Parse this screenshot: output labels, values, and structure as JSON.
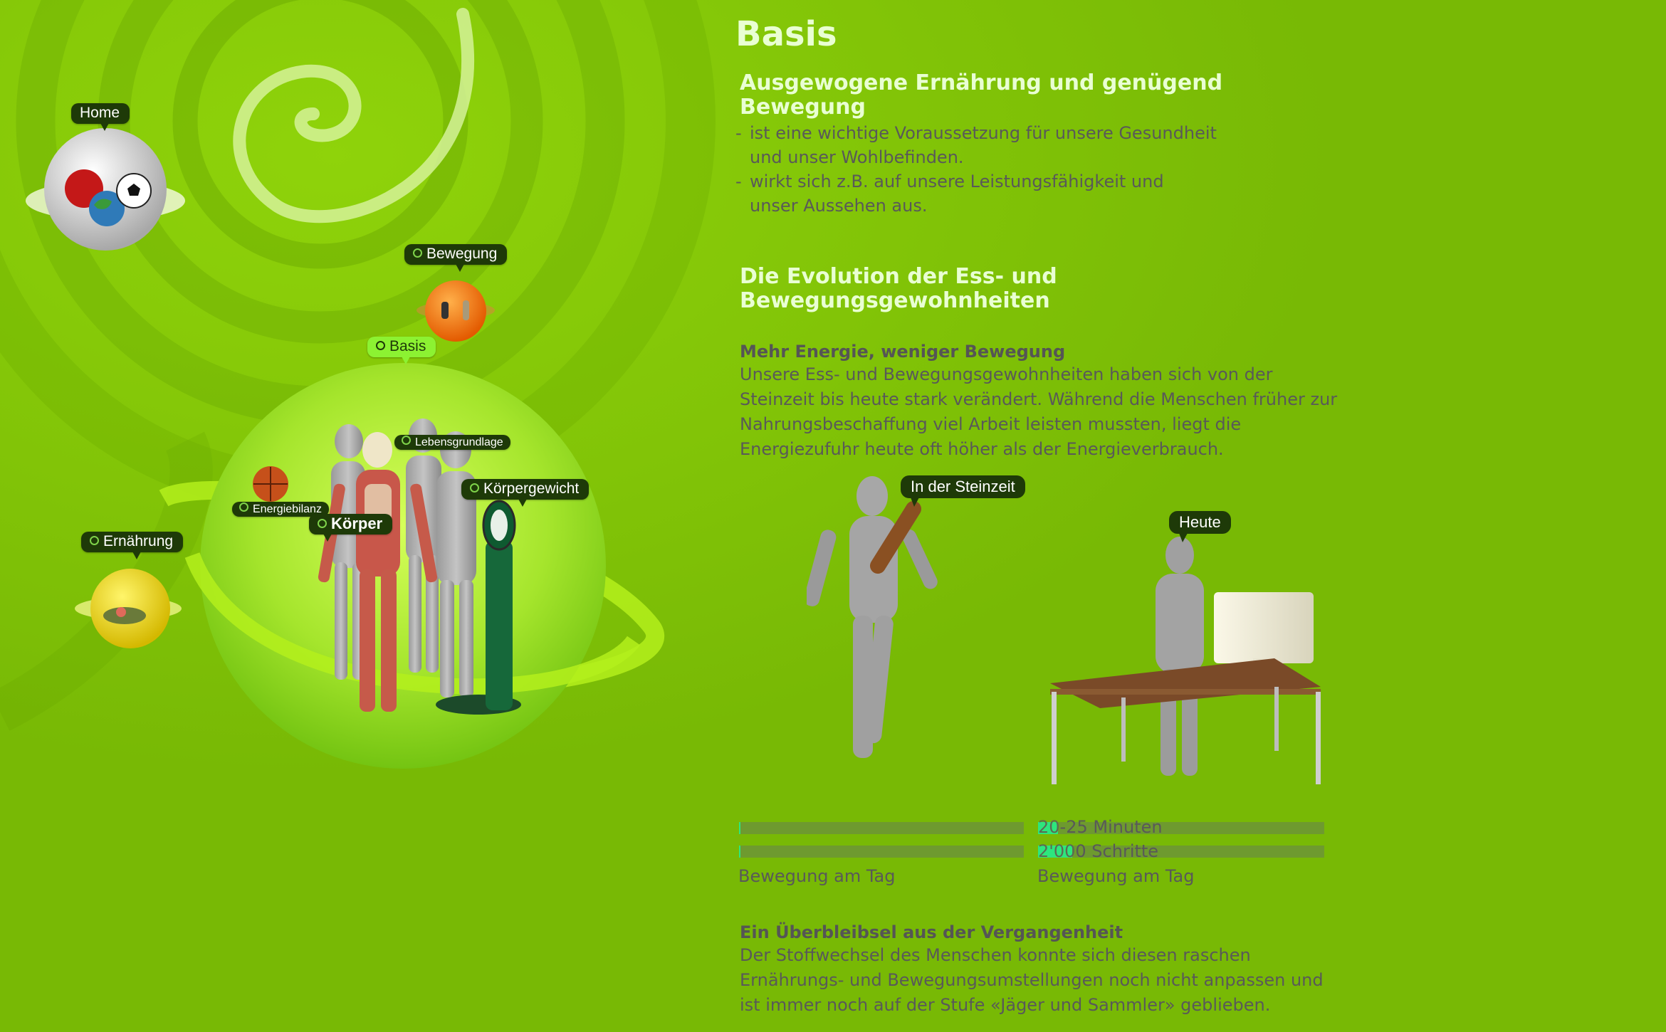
{
  "nav": {
    "home": "Home",
    "bewegung": "Bewegung",
    "basis": "Basis",
    "ernaehrung": "Ernährung",
    "lebensgrundlage": "Lebensgrundlage",
    "energiebilanz": "Energiebilanz",
    "koerper": "Körper",
    "koerpergewicht": "Körpergewicht"
  },
  "content": {
    "title": "Basis",
    "section1": {
      "heading": "Ausgewogene Ernährung und genügend Bewegung",
      "bullets": [
        "ist eine wichtige Voraussetzung für unsere Gesundheit und unser Wohlbefinden.",
        "wirkt sich z.B. auf unsere Leistungsfähigkeit und unser Aussehen aus."
      ]
    },
    "section2": {
      "heading": "Die Evolution der Ess- und Bewegungsgewohnheiten",
      "sub1": "Mehr Energie, weniger Bewegung",
      "text1": "Unsere Ess- und Bewegungsgewohnheiten haben sich von der Steinzeit bis heute stark verändert. Während die Menschen früher zur Nahrungsbeschaffung viel Arbeit leisten mussten, liegt die Energiezufuhr heute oft höher als der Energieverbrauch.",
      "sub2": "Ein Überbleibsel aus der Vergangenheit",
      "text2": "Der Stoffwechsel des Menschen konnte sich diesen raschen Ernährungs- und Bewegungsumstellungen noch nicht anpassen und ist immer noch auf der Stufe «Jäger und Sammler» geblieben."
    },
    "comparison": {
      "stone_age": {
        "label": "In der Steinzeit",
        "minutes_fill": 0.005,
        "steps_fill": 0.005,
        "caption": "Bewegung am Tag"
      },
      "today": {
        "label": "Heute",
        "minutes_hl": "20",
        "minutes_rest": "-25 Minuten",
        "steps_hl": "2'00",
        "steps_rest": "0 Schritte",
        "minutes_fill": 0.07,
        "steps_fill": 0.12,
        "caption": "Bewegung am Tag"
      }
    }
  },
  "colors": {
    "background": "#78b905",
    "heading": "#e9ffd3",
    "label_bg": "#1e3a08",
    "active_label_bg": "#8cf232",
    "progress_fill": "#2de67e",
    "progress_track": "#6e9a2f"
  }
}
